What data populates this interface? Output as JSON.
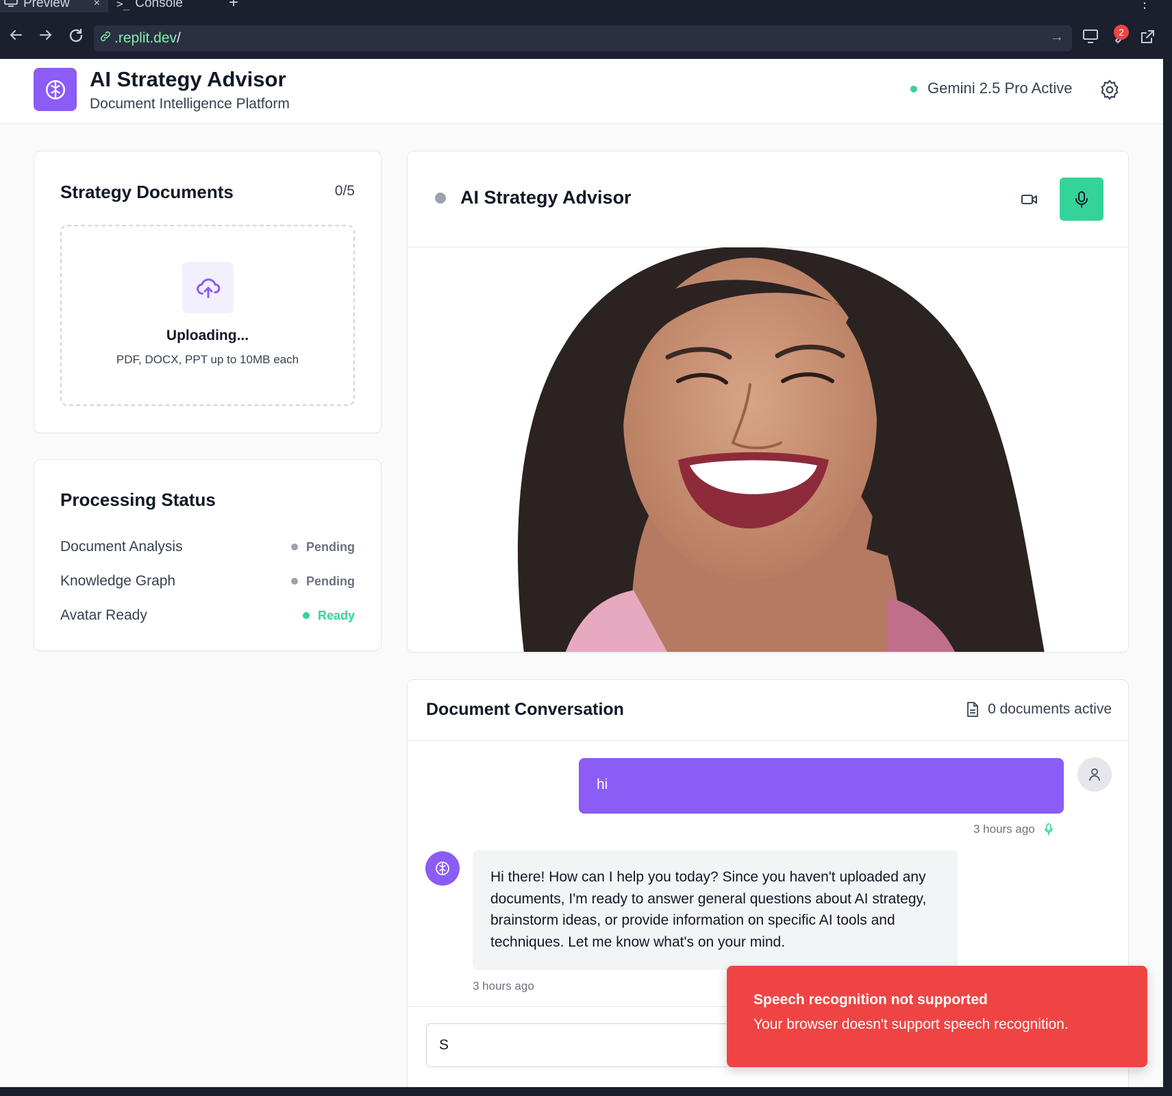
{
  "browser": {
    "tabs": [
      {
        "label": "Preview",
        "close": "×"
      },
      {
        "label": "Console"
      }
    ],
    "new_tab": "+",
    "url_prefix": ".replit.dev",
    "url_suffix": "/",
    "notification_count": "2"
  },
  "header": {
    "title": "AI Strategy Advisor",
    "subtitle": "Document Intelligence Platform",
    "model_status": "Gemini 2.5 Pro Active"
  },
  "documents": {
    "title": "Strategy Documents",
    "count": "0/5",
    "upload_title": "Uploading...",
    "upload_hint": "PDF, DOCX, PPT up to 10MB each"
  },
  "processing": {
    "title": "Processing Status",
    "items": [
      {
        "label": "Document Analysis",
        "state": "Pending"
      },
      {
        "label": "Knowledge Graph",
        "state": "Pending"
      },
      {
        "label": "Avatar Ready",
        "state": "Ready"
      }
    ]
  },
  "advisor": {
    "title": "AI Strategy Advisor"
  },
  "conversation": {
    "title": "Document Conversation",
    "docs_active": "0 documents active",
    "messages": [
      {
        "role": "user",
        "text": "hi",
        "time": "3 hours ago"
      },
      {
        "role": "assistant",
        "text": "Hi there! How can I help you today? Since you haven't uploaded any documents, I'm ready to answer general questions about AI strategy, brainstorm ideas, or provide information on specific AI tools and techniques. Let me know what's on your mind.",
        "time": "3 hours ago"
      }
    ],
    "input_value": "S"
  },
  "toast": {
    "title": "Speech recognition not supported",
    "description": "Your browser doesn't support speech recognition."
  },
  "colors": {
    "primary": "#8b5cf6",
    "success": "#34d399",
    "danger": "#ef4444"
  }
}
